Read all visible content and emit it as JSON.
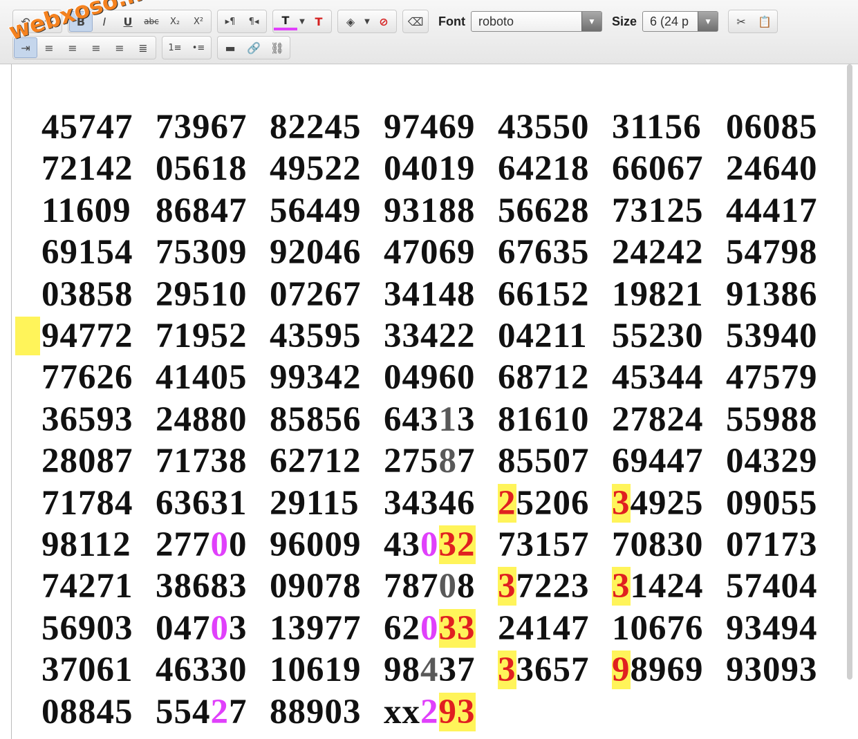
{
  "watermark": "webxoso.net",
  "toolbar": {
    "row1": {
      "undo": "↶",
      "redo": "↷",
      "bold": "B",
      "italic": "I",
      "underline": "U",
      "strike": "abc",
      "subscript": "X₂",
      "superscript": "X²",
      "ltr": "▸¶",
      "rtl": "¶◂",
      "text_color": "T",
      "remove_color": "T",
      "fill_color": "◈",
      "no_fill": "⊘",
      "eraser": "⌫",
      "font_label": "Font",
      "font_value": "roboto",
      "size_label": "Size",
      "size_value": "6 (24 p",
      "cut": "✂",
      "paste": "📋"
    },
    "row2": {
      "indent": "⇥",
      "align_left": "≡",
      "align_center": "≡",
      "align_right": "≡",
      "justify": "≡",
      "justify_all": "≣",
      "ordered_list": "1≡",
      "bullet_list": "•≡",
      "hr": "▬",
      "link": "🔗",
      "unlink": "⛓"
    }
  },
  "grid": [
    [
      "45747",
      "73967",
      "82245",
      "97469",
      "43550",
      "31156",
      "06085"
    ],
    [
      "72142",
      "05618",
      "49522",
      "04019",
      "64218",
      "66067",
      "24640"
    ],
    [
      "11609",
      "86847",
      "56449",
      "93188",
      "56628",
      "73125",
      "44417"
    ],
    [
      "69154",
      "75309",
      "92046",
      "47069",
      "67635",
      "24242",
      "54798"
    ],
    [
      "03858",
      "29510",
      "07267",
      "34148",
      "66152",
      "19821",
      "91386"
    ],
    [
      "94772",
      "71952",
      "43595",
      "33422",
      "04211",
      "55230",
      "53940"
    ],
    [
      "77626",
      "41405",
      "99342",
      "04960",
      "68712",
      "45344",
      "47579"
    ],
    [
      "36593",
      "24880",
      "85856",
      "64313",
      "81610",
      "27824",
      "55988"
    ],
    [
      "28087",
      "71738",
      "62712",
      "27587",
      "85507",
      "69447",
      "04329"
    ],
    [
      "71784",
      "63631",
      "29115",
      "34346",
      "25206",
      "34925",
      "09055"
    ],
    [
      "98112",
      "27700",
      "96009",
      "43032",
      "73157",
      "70830",
      "07173"
    ],
    [
      "74271",
      "38683",
      "09078",
      "78708",
      "37223",
      "31424",
      "57404"
    ],
    [
      "56903",
      "04703",
      "13977",
      "62033",
      "24147",
      "10676",
      "93494"
    ],
    [
      "37061",
      "46330",
      "10619",
      "98437",
      "33657",
      "98969",
      "93093"
    ],
    [
      "08845",
      "55427",
      "88903",
      "xx293"
    ]
  ],
  "highlights": {
    "7-3": [
      [
        3,
        "gray"
      ]
    ],
    "8-3": [
      [
        3,
        "gray"
      ]
    ],
    "9-4": [
      [
        0,
        "red hl"
      ]
    ],
    "9-5": [
      [
        0,
        "red hl"
      ]
    ],
    "10-1": [
      [
        3,
        "pink"
      ]
    ],
    "10-3": [
      [
        2,
        "pink"
      ],
      [
        3,
        "red hl"
      ],
      [
        4,
        "red hl"
      ]
    ],
    "11-3": [
      [
        3,
        "gray"
      ]
    ],
    "11-4": [
      [
        0,
        "red hl"
      ]
    ],
    "11-5": [
      [
        0,
        "red hl"
      ]
    ],
    "12-1": [
      [
        3,
        "pink"
      ]
    ],
    "12-3": [
      [
        2,
        "pink"
      ],
      [
        3,
        "red hl"
      ],
      [
        4,
        "red hl"
      ]
    ],
    "13-3": [
      [
        2,
        "gray"
      ]
    ],
    "13-4": [
      [
        0,
        "red hl"
      ]
    ],
    "13-5": [
      [
        0,
        "red hl"
      ]
    ],
    "14-1": [
      [
        3,
        "pink"
      ]
    ],
    "14-3": [
      [
        2,
        "pink"
      ],
      [
        3,
        "red hl"
      ],
      [
        4,
        "red hl"
      ]
    ]
  }
}
